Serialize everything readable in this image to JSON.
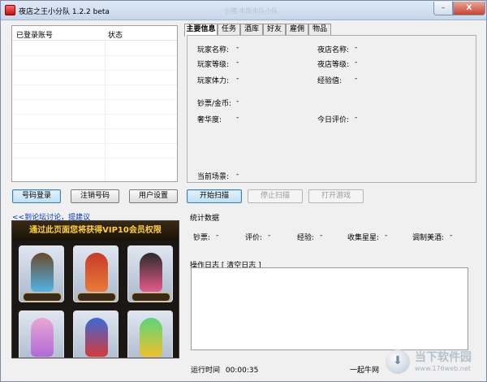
{
  "window": {
    "title": "夜店之王小分队 1.2.2 beta",
    "ghost_title": "小猪·本版本队小队",
    "minimize": "–",
    "close": "X"
  },
  "accounts": {
    "col_account": "已登录账号",
    "col_status": "状态"
  },
  "left_buttons": {
    "login": "号码登录",
    "logout": "注销号码",
    "settings": "用户设置"
  },
  "links": {
    "forum": "<<到论坛讨论",
    "separator": "，",
    "suggest": "提建议"
  },
  "promo": {
    "banner": "通过此页面您将获得VIP10会员权限"
  },
  "tabs": [
    "主要信息",
    "任务",
    "酒库",
    "好友",
    "雇佣",
    "物品"
  ],
  "info": {
    "player_name": "玩家名称:",
    "player_name_value": "-",
    "player_level": "玩家等级:",
    "player_level_value": "-",
    "player_stamina": "玩家体力:",
    "player_stamina_value": "-",
    "cash_coins": "钞票/金币:",
    "cash_coins_value": "-",
    "luxury": "奢华度:",
    "luxury_value": "-",
    "club_name": "夜店名称:",
    "club_name_value": "-",
    "club_level": "夜店等级:",
    "club_level_value": "-",
    "experience": "经验值:",
    "experience_value": "-",
    "today_rating": "今日评价:",
    "today_rating_value": "-",
    "current_scene": "当前场景:",
    "current_scene_value": "-"
  },
  "scan_buttons": {
    "start": "开始扫描",
    "stop": "停止扫描",
    "open_game": "打开游戏"
  },
  "stats": {
    "title": "统计数据",
    "cash": "钞票:",
    "cash_value": "-",
    "rating": "评价:",
    "rating_value": "-",
    "exp": "经验:",
    "exp_value": "-",
    "stars": "收集星星:",
    "stars_value": "-",
    "mixer": "调制美酒:",
    "mixer_value": "-"
  },
  "log": {
    "title": "操作日志 [ 清空日志 ]"
  },
  "status": {
    "runtime_label": "运行时间",
    "runtime_value": "00:00:35",
    "brand": "一起牛网"
  },
  "watermark": {
    "text": "当下软件园",
    "url": "www.176web.net"
  },
  "colors": {
    "accent": "#3c7fb1",
    "link": "#0033cc",
    "banner_text": "#ffd23a"
  }
}
